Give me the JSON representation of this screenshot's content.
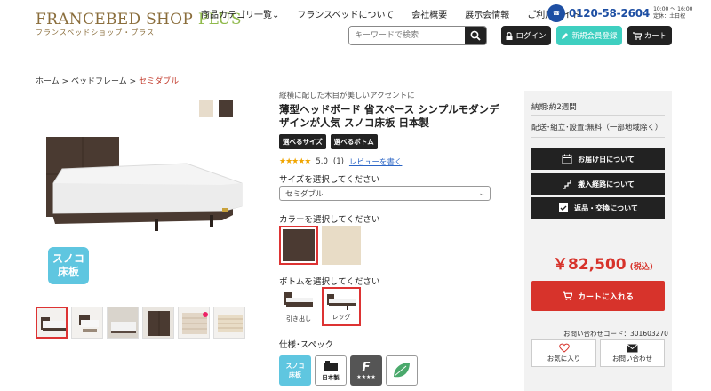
{
  "header": {
    "logo_main": "FRANCEBED SHOP",
    "logo_plus": "PLUS",
    "logo_sub": "フランスベッドショップ・プラス",
    "nav": [
      "商品カテゴリ一覧",
      "フランスベッドについて",
      "会社概要",
      "展示会情報",
      "ご利用ガイド"
    ],
    "tel": "0120-58-2604",
    "tel_hours_1": "10:00 ～ 16:00",
    "tel_hours_2": "定休：土日祝",
    "search_placeholder": "キーワードで検索",
    "login_label": "ログイン",
    "register_label": "新規会員登録",
    "cart_label": "カート"
  },
  "breadcrumb": {
    "home": "ホーム",
    "sep": ">",
    "category": "ベッドフレーム",
    "current": "セミダブル"
  },
  "gallery": {
    "badge_line1": "スノコ",
    "badge_line2": "床板",
    "swatch_colors": [
      "#e7dccb",
      "#4a3b33"
    ]
  },
  "product": {
    "lead": "縦横に配した木目が美しいアクセントに",
    "title": "薄型ヘッドボード 省スペース シンプルモダンデザインが人気 スノコ床板 日本製",
    "tags": [
      "選べるサイズ",
      "選べるボトム"
    ],
    "stars": "★★★★★",
    "rating": "5.0",
    "review_count": "(1)",
    "review_link": "レビューを書く",
    "size_label": "サイズを選択してください",
    "size_value": "セミダブル",
    "color_label": "カラーを選択してください",
    "colors": [
      "#4b3a32",
      "#e8dcc6"
    ],
    "bottom_label": "ボトムを選択してください",
    "bottoms": [
      "引き出し",
      "レッグ"
    ],
    "spec_label": "仕様･スペック",
    "spec_icons": {
      "sunoko_1": "スノコ",
      "sunoko_2": "床板",
      "japan": "日本製",
      "f4": "F",
      "f4_stars": "★★★★"
    }
  },
  "side": {
    "lead_time": "納期:約2週間",
    "delivery": "配送･組立･設置:無料（一部地域除く）",
    "btn_delivery_date": "お届け日について",
    "btn_route": "搬入経路について",
    "btn_return": "返品・交換について",
    "price": "￥82,500",
    "tax": "(税込)",
    "add_to_cart": "カートに入れる",
    "inquiry_code": "お問い合わせコード：301603270",
    "favorite": "お気に入り",
    "inquiry": "お問い合わせ"
  },
  "colors": {
    "accent_red": "#d7332b",
    "teal": "#3ecfc0",
    "brand_brown": "#8a6d3b",
    "tel_blue": "#1e4fa3"
  }
}
